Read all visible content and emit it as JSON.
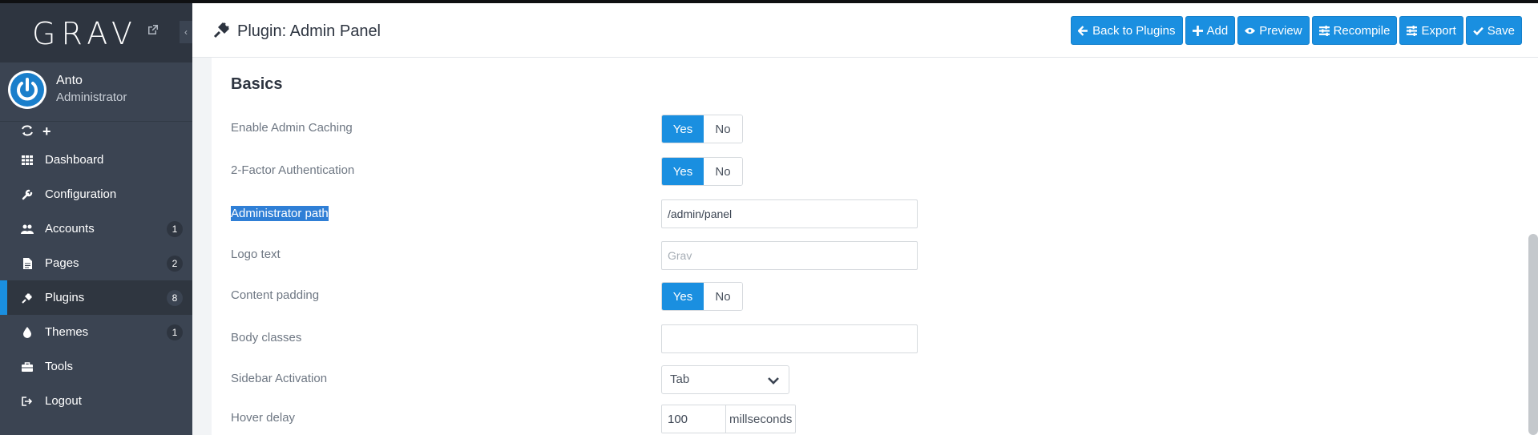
{
  "app": {
    "logo": "GRAV"
  },
  "user": {
    "name": "Anto",
    "role": "Administrator"
  },
  "quick_actions": [
    {
      "icon": "refresh-icon"
    },
    {
      "icon": "plus-icon"
    }
  ],
  "sidebar": {
    "items": [
      {
        "label": "Dashboard",
        "icon": "grid-icon",
        "badge": ""
      },
      {
        "label": "Configuration",
        "icon": "wrench-icon",
        "badge": ""
      },
      {
        "label": "Accounts",
        "icon": "users-icon",
        "badge": "1"
      },
      {
        "label": "Pages",
        "icon": "file-icon",
        "badge": "2"
      },
      {
        "label": "Plugins",
        "icon": "plug-icon",
        "badge": "8",
        "active": true
      },
      {
        "label": "Themes",
        "icon": "tint-icon",
        "badge": "1"
      },
      {
        "label": "Tools",
        "icon": "briefcase-icon",
        "badge": ""
      },
      {
        "label": "Logout",
        "icon": "logout-icon",
        "badge": ""
      }
    ]
  },
  "header": {
    "title": "Plugin: Admin Panel",
    "buttons": {
      "back": "Back to Plugins",
      "add": "Add",
      "preview": "Preview",
      "recompile": "Recompile",
      "export": "Export",
      "save": "Save"
    }
  },
  "form": {
    "section_title": "Basics",
    "caching_label": "Enable Admin Caching",
    "twofa_label": "2-Factor Authentication",
    "admin_path_label": "Administrator path",
    "admin_path_value": "/admin/panel",
    "logo_text_label": "Logo text",
    "logo_text_placeholder": "Grav",
    "content_padding_label": "Content padding",
    "body_classes_label": "Body classes",
    "body_classes_value": "",
    "sidebar_activation_label": "Sidebar Activation",
    "sidebar_activation_value": "Tab",
    "hover_delay_label": "Hover delay",
    "hover_delay_value": "100",
    "hover_delay_unit": "millseconds",
    "yes": "Yes",
    "no": "No"
  },
  "colors": {
    "accent": "#1a8fe0",
    "sidebar": "#3b4452",
    "sidebar_dark": "#2e3540"
  }
}
